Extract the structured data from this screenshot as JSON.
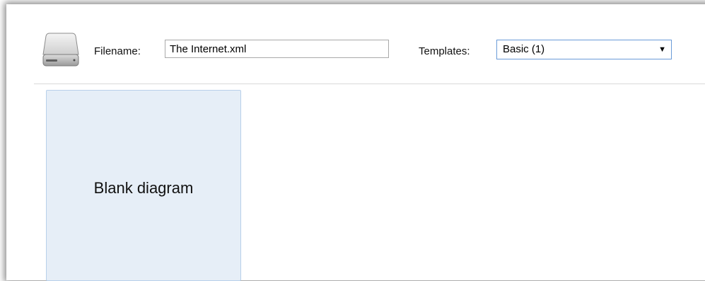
{
  "header": {
    "filename_label": "Filename:",
    "filename_value": "The Internet.xml",
    "templates_label": "Templates:",
    "templates_selected": "Basic (1)",
    "dropdown_arrow": "▼",
    "icon": "disk-drive-icon"
  },
  "templates": {
    "items": [
      {
        "label": "Blank diagram"
      }
    ]
  },
  "colors": {
    "tile_background": "#e6eef7",
    "tile_border": "#b8d0ea",
    "select_border": "#6a9bd8"
  }
}
